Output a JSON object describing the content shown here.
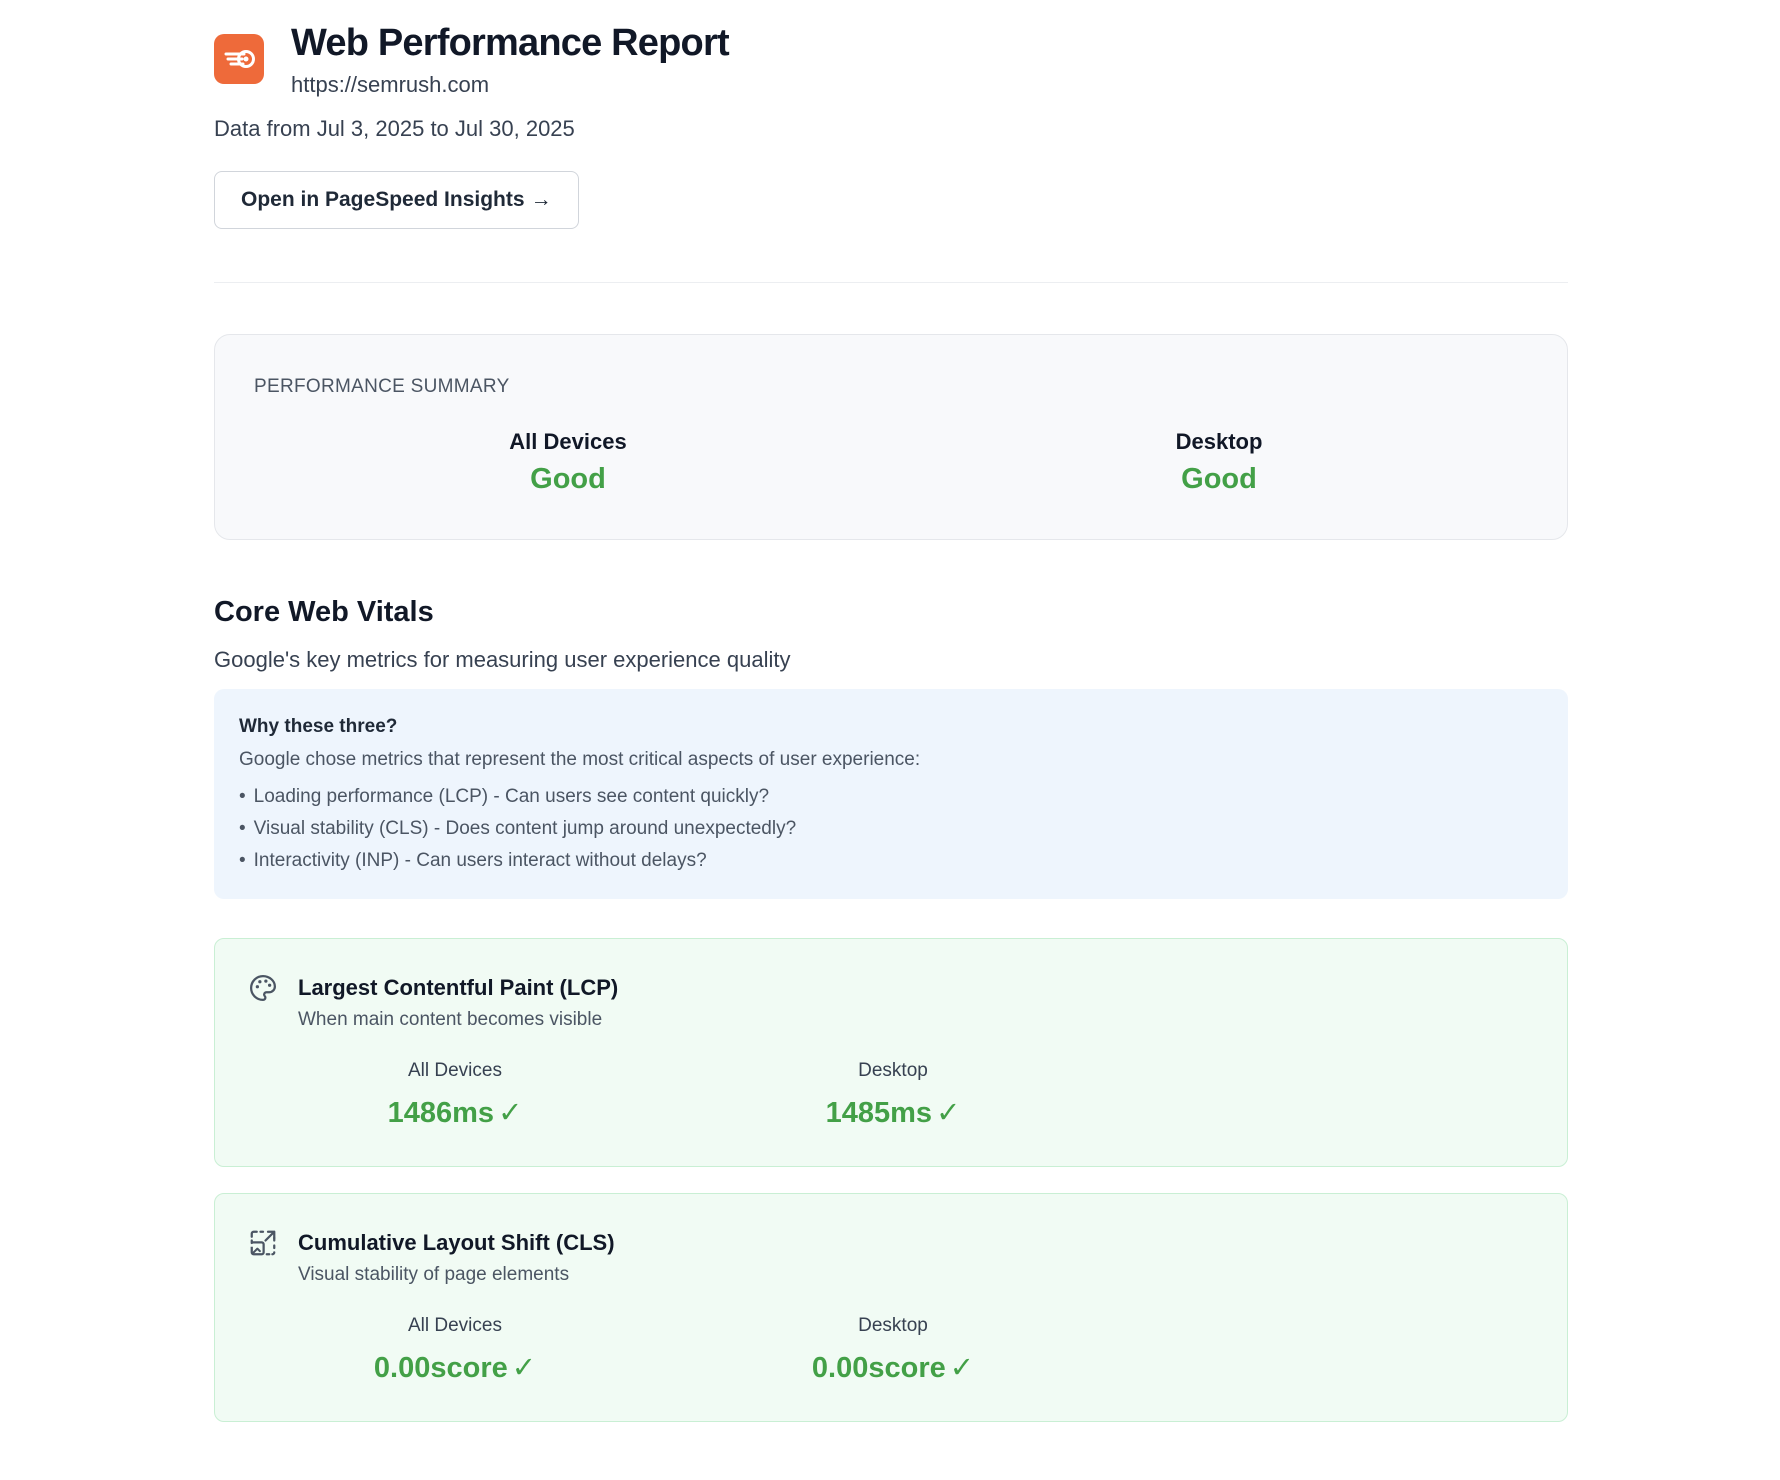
{
  "colors": {
    "brand": "#ee6a3a",
    "good": "#43a047",
    "info_bg": "#eef5fd",
    "good_card_bg": "#f1fbf4"
  },
  "header": {
    "logo_icon": "semrush-logo-icon",
    "title": "Web Performance Report",
    "url": "https://semrush.com",
    "date_range": "Data from Jul 3, 2025 to Jul 30, 2025",
    "psi_button_label": "Open in PageSpeed Insights",
    "psi_button_icon": "→"
  },
  "summary": {
    "label": "PERFORMANCE SUMMARY",
    "columns": [
      {
        "name": "All Devices",
        "status": "Good"
      },
      {
        "name": "Desktop",
        "status": "Good"
      }
    ]
  },
  "core_web_vitals": {
    "title": "Core Web Vitals",
    "subtitle": "Google's key metrics for measuring user experience quality",
    "info": {
      "title": "Why these three?",
      "text": "Google chose metrics that represent the most critical aspects of user experience:",
      "bullets": [
        "Loading performance (LCP) - Can users see content quickly?",
        "Visual stability (CLS) - Does content jump around unexpectedly?",
        "Interactivity (INP) - Can users interact without delays?"
      ],
      "bullet_symbol": "•"
    },
    "metrics": [
      {
        "icon": "palette-icon",
        "name": "Largest Contentful Paint (LCP)",
        "description": "When main content becomes visible",
        "values": [
          {
            "device": "All Devices",
            "value": "1486ms",
            "check": "✓"
          },
          {
            "device": "Desktop",
            "value": "1485ms",
            "check": "✓"
          }
        ]
      },
      {
        "icon": "layout-shift-icon",
        "name": "Cumulative Layout Shift (CLS)",
        "description": "Visual stability of page elements",
        "values": [
          {
            "device": "All Devices",
            "value": "0.00score",
            "check": "✓"
          },
          {
            "device": "Desktop",
            "value": "0.00score",
            "check": "✓"
          }
        ]
      }
    ]
  }
}
